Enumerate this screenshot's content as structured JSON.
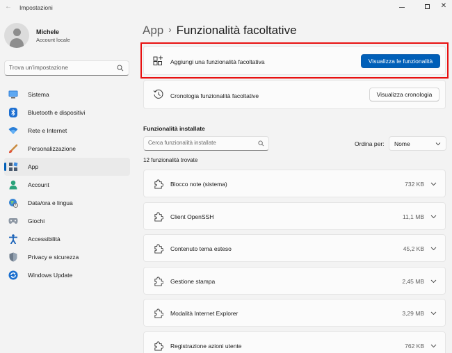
{
  "window": {
    "title": "Impostazioni",
    "back_glyph": "←",
    "close_glyph": "✕"
  },
  "user": {
    "name": "Michele",
    "account_type": "Account locale"
  },
  "search": {
    "placeholder": "Trova un'impostazione"
  },
  "sidebar": {
    "items": [
      {
        "label": "Sistema",
        "icon": "monitor-icon"
      },
      {
        "label": "Bluetooth e dispositivi",
        "icon": "bluetooth-icon"
      },
      {
        "label": "Rete e Internet",
        "icon": "wifi-icon"
      },
      {
        "label": "Personalizzazione",
        "icon": "brush-icon"
      },
      {
        "label": "App",
        "icon": "apps-icon",
        "active": true
      },
      {
        "label": "Account",
        "icon": "person-icon"
      },
      {
        "label": "Data/ora e lingua",
        "icon": "globe-clock-icon"
      },
      {
        "label": "Giochi",
        "icon": "gamepad-icon"
      },
      {
        "label": "Accessibilità",
        "icon": "accessibility-icon"
      },
      {
        "label": "Privacy e sicurezza",
        "icon": "shield-icon"
      },
      {
        "label": "Windows Update",
        "icon": "update-icon"
      }
    ]
  },
  "breadcrumb": {
    "parent": "App",
    "separator": "›",
    "current": "Funzionalità facoltative"
  },
  "add_feature": {
    "label": "Aggiungi una funzionalità facoltativa",
    "button": "Visualizza le funzionalità"
  },
  "history": {
    "label": "Cronologia funzionalità facoltative",
    "button": "Visualizza cronologia"
  },
  "installed": {
    "title": "Funzionalità installate",
    "search_placeholder": "Cerca funzionalità installate",
    "sort_label": "Ordina per:",
    "sort_value": "Nome",
    "count_text": "12 funzionalità trovate",
    "features": [
      {
        "name": "Blocco note (sistema)",
        "size": "732 KB"
      },
      {
        "name": "Client OpenSSH",
        "size": "11,1 MB"
      },
      {
        "name": "Contenuto tema esteso",
        "size": "45,2 KB"
      },
      {
        "name": "Gestione stampa",
        "size": "2,45 MB"
      },
      {
        "name": "Modalità Internet Explorer",
        "size": "3,29 MB"
      },
      {
        "name": "Registrazione azioni utente",
        "size": "762 KB"
      }
    ]
  },
  "colors": {
    "accent": "#005fb8",
    "highlight": "#e81010",
    "background": "#f3f3f3",
    "card": "#fbfbfb"
  }
}
